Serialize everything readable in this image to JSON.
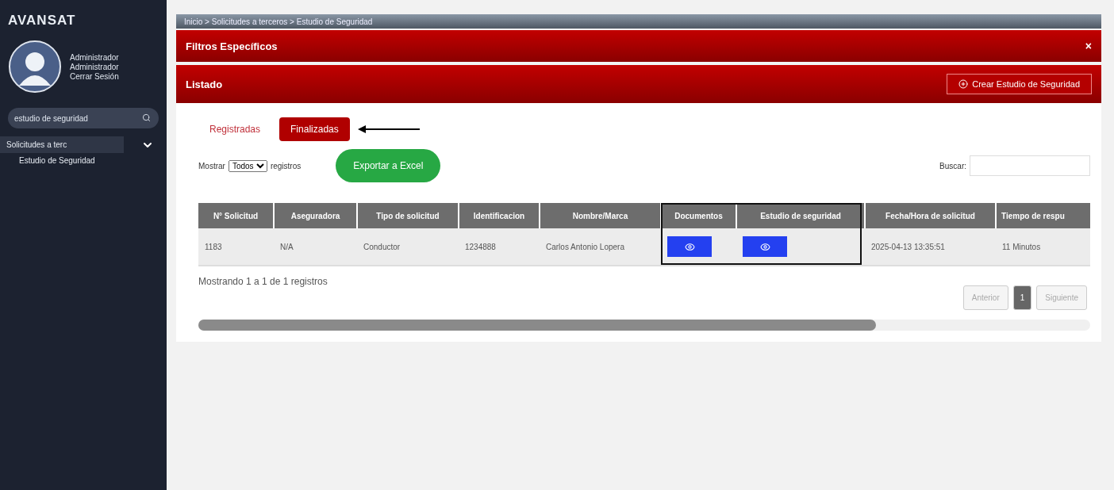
{
  "sidebar": {
    "logo": "AVANSAT",
    "user": {
      "name": "Administrador",
      "role": "Administrador",
      "logout": "Cerrar Sesión"
    },
    "search": {
      "value": "estudio de seguridad"
    },
    "menu": [
      {
        "label": "Solicitudes a terc",
        "expanded": true,
        "children": [
          {
            "label": "Estudio de Seguridad"
          }
        ]
      }
    ]
  },
  "breadcrumb": "Inicio > Solicitudes a terceros > Estudio de Seguridad",
  "filters_panel": {
    "title": "Filtros Específicos",
    "close": "×"
  },
  "list_panel": {
    "title": "Listado",
    "create_button": "Crear Estudio de Seguridad"
  },
  "tabs": [
    {
      "label": "Registradas",
      "selected": false
    },
    {
      "label": "Finalizadas",
      "selected": true
    }
  ],
  "controls": {
    "show_label": "Mostrar",
    "show_value": "Todos",
    "records_label": "registros",
    "export_button": "Exportar a Excel",
    "search_label": "Buscar:"
  },
  "table": {
    "columns": [
      "N° Solicitud",
      "Aseguradora",
      "Tipo de solicitud",
      "Identificacion",
      "Nombre/Marca",
      "Documentos",
      "Estudio de seguridad",
      "Fecha/Hora de solicitud",
      "Tiempo de respu"
    ],
    "rows": [
      {
        "cells": [
          {
            "kind": "text",
            "text": "1183"
          },
          {
            "kind": "text",
            "text": "N/A"
          },
          {
            "kind": "text",
            "text": "Conductor"
          },
          {
            "kind": "text",
            "text": "1234888"
          },
          {
            "kind": "text",
            "text": "Carlos Antonio Lopera"
          },
          {
            "kind": "view"
          },
          {
            "kind": "view"
          },
          {
            "kind": "text",
            "text": "2025-04-13 13:35:51"
          },
          {
            "kind": "text",
            "text": "11 Minutos"
          }
        ]
      }
    ]
  },
  "footer": {
    "info": "Mostrando 1 a 1 de 1 registros",
    "pagination": [
      {
        "label": "Anterior",
        "kind": "nav",
        "selected": false
      },
      {
        "label": "1",
        "kind": "page",
        "selected": true
      },
      {
        "label": "Siguiente",
        "kind": "nav",
        "selected": false
      }
    ]
  }
}
